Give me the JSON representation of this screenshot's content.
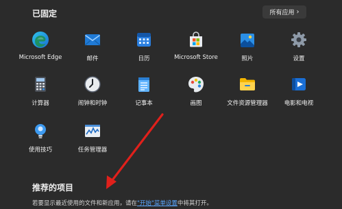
{
  "pinned": {
    "title": "已固定",
    "all_apps_label": "所有应用"
  },
  "apps": [
    {
      "name": "Microsoft Edge",
      "icon": "edge-icon"
    },
    {
      "name": "邮件",
      "icon": "mail-icon"
    },
    {
      "name": "日历",
      "icon": "calendar-icon"
    },
    {
      "name": "Microsoft Store",
      "icon": "store-icon"
    },
    {
      "name": "照片",
      "icon": "photos-icon"
    },
    {
      "name": "设置",
      "icon": "settings-gear-icon"
    },
    {
      "name": "计算器",
      "icon": "calculator-icon"
    },
    {
      "name": "闹钟和时钟",
      "icon": "clock-icon"
    },
    {
      "name": "记事本",
      "icon": "notepad-icon"
    },
    {
      "name": "画图",
      "icon": "paint-icon"
    },
    {
      "name": "文件资源管理器",
      "icon": "folder-icon"
    },
    {
      "name": "电影和电视",
      "icon": "movies-tv-icon"
    },
    {
      "name": "使用技巧",
      "icon": "tips-bulb-icon"
    },
    {
      "name": "任务管理器",
      "icon": "task-manager-icon"
    }
  ],
  "recommended": {
    "title": "推荐的项目",
    "hint_prefix": "若要显示最近使用的文件和新应用，请在",
    "hint_link": "\"开始\"菜单设置",
    "hint_suffix": "中将其打开。"
  },
  "colors": {
    "background": "#2b2b2b",
    "accent_link": "#5aa7ff",
    "arrow": "#e0201b"
  }
}
